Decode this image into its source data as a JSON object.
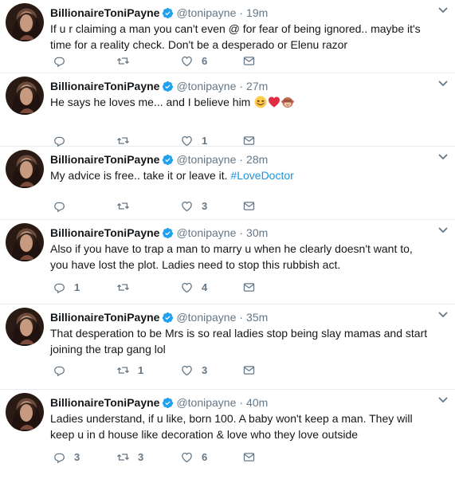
{
  "author": {
    "display_name": "BillionaireToniPayne",
    "handle": "@tonipayne",
    "verified_icon": "verified-badge-icon",
    "accent_color": "#1da1f2"
  },
  "colors": {
    "text": "#14171a",
    "muted": "#657786",
    "link": "#1b95e0",
    "divider": "#e6ecf0"
  },
  "tweets": [
    {
      "time": "19m",
      "lines": [
        "If u r claiming a man you can't even @ for fear of being ignored.. maybe it's",
        "time for a reality check. Don't be a desperado or Elenu razor"
      ],
      "replies": "",
      "retweets": "",
      "likes": "6"
    },
    {
      "time": "27m",
      "lines": [
        "He says he loves me... and I believe him"
      ],
      "emojis": [
        "smiling-face-icon",
        "red-heart-icon",
        "see-no-evil-monkey-icon"
      ],
      "replies": "",
      "retweets": "",
      "likes": "1"
    },
    {
      "time": "28m",
      "lines": [
        "My advice is free.. take it or leave it."
      ],
      "hashtag": "#LoveDoctor",
      "replies": "",
      "retweets": "",
      "likes": "3"
    },
    {
      "time": "30m",
      "lines": [
        "Also if you have to trap a man to marry u when he clearly doesn't want to,",
        "you have lost the plot. Ladies need to stop this rubbish act."
      ],
      "replies": "1",
      "retweets": "",
      "likes": "4"
    },
    {
      "time": "35m",
      "lines": [
        "That desperation to be Mrs is so real ladies stop being slay mamas and start",
        "joining the trap gang lol"
      ],
      "replies": "",
      "retweets": "1",
      "likes": "3"
    },
    {
      "time": "40m",
      "lines": [
        "Ladies understand, if u like, born 100. A baby won't keep a man. They will",
        "keep u in d house like decoration & love who they love outside"
      ],
      "replies": "3",
      "retweets": "3",
      "likes": "6"
    }
  ]
}
